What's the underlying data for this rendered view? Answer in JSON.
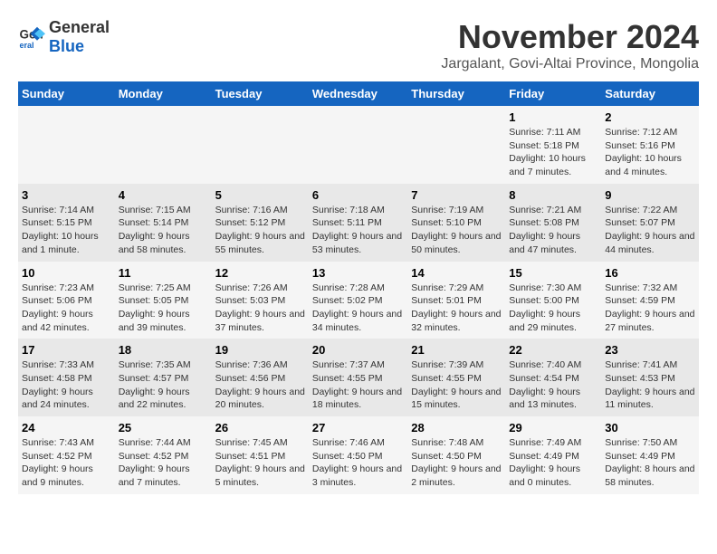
{
  "logo": {
    "general": "General",
    "blue": "Blue"
  },
  "title": "November 2024",
  "location": "Jargalant, Govi-Altai Province, Mongolia",
  "headers": [
    "Sunday",
    "Monday",
    "Tuesday",
    "Wednesday",
    "Thursday",
    "Friday",
    "Saturday"
  ],
  "rows": [
    {
      "cells": [
        {
          "day": "",
          "info": ""
        },
        {
          "day": "",
          "info": ""
        },
        {
          "day": "",
          "info": ""
        },
        {
          "day": "",
          "info": ""
        },
        {
          "day": "",
          "info": ""
        },
        {
          "day": "1",
          "info": "Sunrise: 7:11 AM\nSunset: 5:18 PM\nDaylight: 10 hours and 7 minutes."
        },
        {
          "day": "2",
          "info": "Sunrise: 7:12 AM\nSunset: 5:16 PM\nDaylight: 10 hours and 4 minutes."
        }
      ]
    },
    {
      "cells": [
        {
          "day": "3",
          "info": "Sunrise: 7:14 AM\nSunset: 5:15 PM\nDaylight: 10 hours and 1 minute."
        },
        {
          "day": "4",
          "info": "Sunrise: 7:15 AM\nSunset: 5:14 PM\nDaylight: 9 hours and 58 minutes."
        },
        {
          "day": "5",
          "info": "Sunrise: 7:16 AM\nSunset: 5:12 PM\nDaylight: 9 hours and 55 minutes."
        },
        {
          "day": "6",
          "info": "Sunrise: 7:18 AM\nSunset: 5:11 PM\nDaylight: 9 hours and 53 minutes."
        },
        {
          "day": "7",
          "info": "Sunrise: 7:19 AM\nSunset: 5:10 PM\nDaylight: 9 hours and 50 minutes."
        },
        {
          "day": "8",
          "info": "Sunrise: 7:21 AM\nSunset: 5:08 PM\nDaylight: 9 hours and 47 minutes."
        },
        {
          "day": "9",
          "info": "Sunrise: 7:22 AM\nSunset: 5:07 PM\nDaylight: 9 hours and 44 minutes."
        }
      ]
    },
    {
      "cells": [
        {
          "day": "10",
          "info": "Sunrise: 7:23 AM\nSunset: 5:06 PM\nDaylight: 9 hours and 42 minutes."
        },
        {
          "day": "11",
          "info": "Sunrise: 7:25 AM\nSunset: 5:05 PM\nDaylight: 9 hours and 39 minutes."
        },
        {
          "day": "12",
          "info": "Sunrise: 7:26 AM\nSunset: 5:03 PM\nDaylight: 9 hours and 37 minutes."
        },
        {
          "day": "13",
          "info": "Sunrise: 7:28 AM\nSunset: 5:02 PM\nDaylight: 9 hours and 34 minutes."
        },
        {
          "day": "14",
          "info": "Sunrise: 7:29 AM\nSunset: 5:01 PM\nDaylight: 9 hours and 32 minutes."
        },
        {
          "day": "15",
          "info": "Sunrise: 7:30 AM\nSunset: 5:00 PM\nDaylight: 9 hours and 29 minutes."
        },
        {
          "day": "16",
          "info": "Sunrise: 7:32 AM\nSunset: 4:59 PM\nDaylight: 9 hours and 27 minutes."
        }
      ]
    },
    {
      "cells": [
        {
          "day": "17",
          "info": "Sunrise: 7:33 AM\nSunset: 4:58 PM\nDaylight: 9 hours and 24 minutes."
        },
        {
          "day": "18",
          "info": "Sunrise: 7:35 AM\nSunset: 4:57 PM\nDaylight: 9 hours and 22 minutes."
        },
        {
          "day": "19",
          "info": "Sunrise: 7:36 AM\nSunset: 4:56 PM\nDaylight: 9 hours and 20 minutes."
        },
        {
          "day": "20",
          "info": "Sunrise: 7:37 AM\nSunset: 4:55 PM\nDaylight: 9 hours and 18 minutes."
        },
        {
          "day": "21",
          "info": "Sunrise: 7:39 AM\nSunset: 4:55 PM\nDaylight: 9 hours and 15 minutes."
        },
        {
          "day": "22",
          "info": "Sunrise: 7:40 AM\nSunset: 4:54 PM\nDaylight: 9 hours and 13 minutes."
        },
        {
          "day": "23",
          "info": "Sunrise: 7:41 AM\nSunset: 4:53 PM\nDaylight: 9 hours and 11 minutes."
        }
      ]
    },
    {
      "cells": [
        {
          "day": "24",
          "info": "Sunrise: 7:43 AM\nSunset: 4:52 PM\nDaylight: 9 hours and 9 minutes."
        },
        {
          "day": "25",
          "info": "Sunrise: 7:44 AM\nSunset: 4:52 PM\nDaylight: 9 hours and 7 minutes."
        },
        {
          "day": "26",
          "info": "Sunrise: 7:45 AM\nSunset: 4:51 PM\nDaylight: 9 hours and 5 minutes."
        },
        {
          "day": "27",
          "info": "Sunrise: 7:46 AM\nSunset: 4:50 PM\nDaylight: 9 hours and 3 minutes."
        },
        {
          "day": "28",
          "info": "Sunrise: 7:48 AM\nSunset: 4:50 PM\nDaylight: 9 hours and 2 minutes."
        },
        {
          "day": "29",
          "info": "Sunrise: 7:49 AM\nSunset: 4:49 PM\nDaylight: 9 hours and 0 minutes."
        },
        {
          "day": "30",
          "info": "Sunrise: 7:50 AM\nSunset: 4:49 PM\nDaylight: 8 hours and 58 minutes."
        }
      ]
    }
  ]
}
